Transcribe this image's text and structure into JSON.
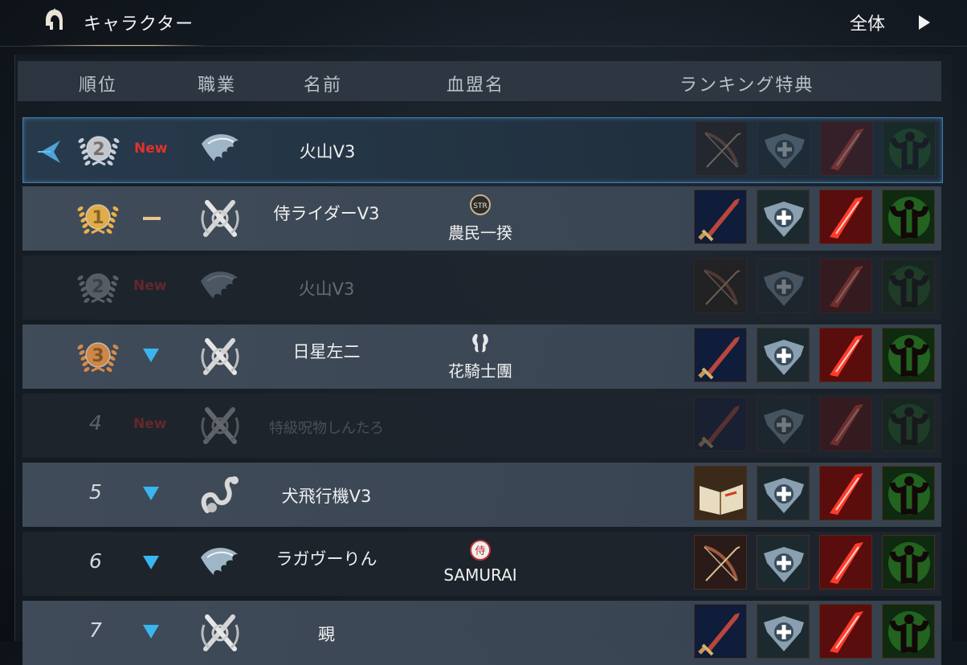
{
  "topbar": {
    "tab_label": "キャラクター",
    "scope_label": "全体",
    "icons": [
      "helmet-icon",
      "play-arrow-icon"
    ]
  },
  "table_header": {
    "rank": "順位",
    "job": "職業",
    "name": "名前",
    "clan": "血盟名",
    "reward": "ランキング特典"
  },
  "rows": [
    {
      "rank": "2",
      "medal": "silver",
      "change": "New",
      "change_type": "new",
      "job_icon": "wing-icon",
      "name": "火山V3",
      "clan_emblem": "",
      "clan": "",
      "rewards": [
        "bow-icon",
        "shield-cross-icon",
        "blade-icon",
        "strength-icon"
      ],
      "state": "selected"
    },
    {
      "rank": "1",
      "medal": "gold",
      "change": "–",
      "change_type": "same",
      "job_icon": "dual-swords-icon",
      "name": "侍ライダーV3",
      "clan_emblem": "STR",
      "clan": "農民一揆",
      "rewards": [
        "sword-icon",
        "shield-cross-icon",
        "blade-icon",
        "strength-icon"
      ],
      "state": "normal"
    },
    {
      "rank": "2",
      "medal": "silver",
      "change": "New",
      "change_type": "new",
      "job_icon": "wing-icon",
      "name": "火山V3",
      "clan_emblem": "",
      "clan": "",
      "rewards": [
        "bow-icon",
        "shield-cross-icon",
        "blade-icon",
        "strength-icon"
      ],
      "state": "dim"
    },
    {
      "rank": "3",
      "medal": "bronze",
      "change": "▼",
      "change_type": "down",
      "job_icon": "dual-swords-icon",
      "name": "日星左二",
      "clan_emblem": "seahorse-emblem",
      "clan": "花騎士團",
      "rewards": [
        "sword-icon",
        "shield-cross-icon",
        "blade-icon",
        "strength-icon"
      ],
      "state": "normal"
    },
    {
      "rank": "4",
      "medal": "",
      "change": "New",
      "change_type": "new",
      "job_icon": "dual-swords-icon",
      "name": "特級呪物しんたろ",
      "clan_emblem": "",
      "clan": "",
      "rewards": [
        "sword-icon",
        "shield-cross-icon",
        "blade-icon",
        "strength-icon"
      ],
      "state": "dim"
    },
    {
      "rank": "5",
      "medal": "",
      "change": "▼",
      "change_type": "down",
      "job_icon": "serpent-icon",
      "name": "犬飛行機V3",
      "clan_emblem": "",
      "clan": "",
      "rewards": [
        "book-icon",
        "shield-cross-icon",
        "blade-icon",
        "strength-icon"
      ],
      "state": "normal"
    },
    {
      "rank": "6",
      "medal": "",
      "change": "▼",
      "change_type": "down",
      "job_icon": "wing-icon",
      "name": "ラガヴーりん",
      "clan_emblem": "侍",
      "clan": "SAMURAI",
      "rewards": [
        "bow-icon",
        "shield-cross-icon",
        "blade-icon",
        "strength-icon"
      ],
      "state": "normal"
    },
    {
      "rank": "7",
      "medal": "",
      "change": "▼",
      "change_type": "down",
      "job_icon": "dual-swords-icon",
      "name": "覡",
      "clan_emblem": "",
      "clan": "",
      "rewards": [
        "sword-icon",
        "shield-cross-icon",
        "blade-icon",
        "strength-icon"
      ],
      "state": "normal"
    }
  ],
  "colors": {
    "new": "#e0312f",
    "down": "#39b6ef",
    "gold": "#e9b24a",
    "silver": "#c9ced6",
    "bronze": "#d58a49"
  }
}
